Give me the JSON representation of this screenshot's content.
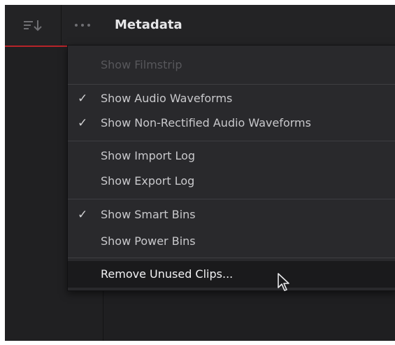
{
  "panel": {
    "title": "Metadata"
  },
  "toolbar": {
    "sort_icon": "sort-descending-icon",
    "more_icon": "more-options-icon"
  },
  "menu": {
    "items": [
      {
        "label": "Show Filmstrip",
        "checked": false,
        "enabled": false
      },
      {
        "label": "Show Audio Waveforms",
        "checked": true,
        "enabled": true
      },
      {
        "label": "Show Non-Rectified Audio Waveforms",
        "checked": true,
        "enabled": true
      },
      {
        "label": "Show Import Log",
        "checked": false,
        "enabled": true
      },
      {
        "label": "Show Export Log",
        "checked": false,
        "enabled": true
      },
      {
        "label": "Show Smart Bins",
        "checked": true,
        "enabled": true
      },
      {
        "label": "Show Power Bins",
        "checked": false,
        "enabled": true
      },
      {
        "label": "Remove Unused Clips...",
        "checked": false,
        "enabled": true,
        "highlighted": true
      }
    ],
    "check_glyph": "✓"
  },
  "colors": {
    "background": "#1f1f21",
    "menu_background": "#29292c",
    "accent": "#b8242a",
    "highlight": "#1a1a1c"
  }
}
